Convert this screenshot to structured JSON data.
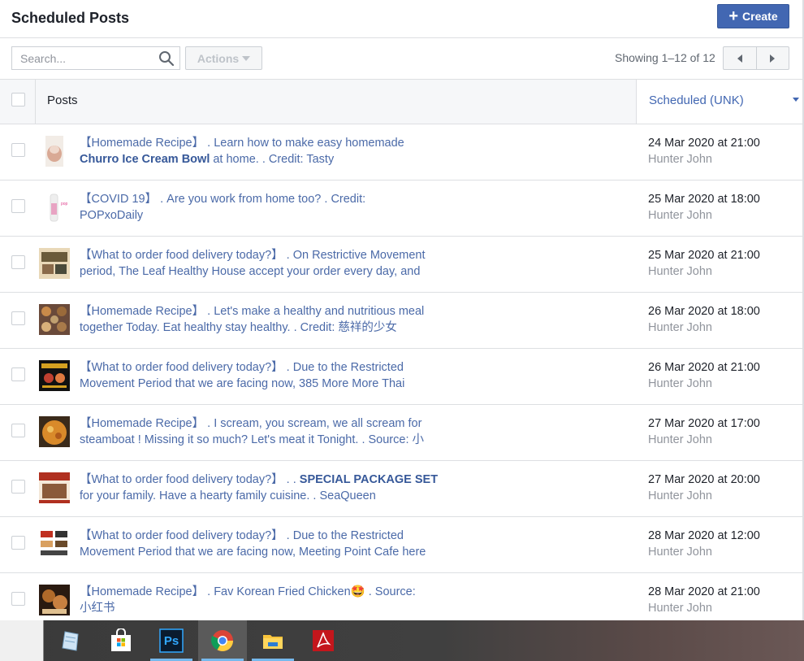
{
  "header": {
    "title": "Scheduled Posts",
    "create_label": "Create"
  },
  "toolbar": {
    "search_placeholder": "Search...",
    "actions_label": "Actions",
    "showing_text": "Showing 1–12 of 12"
  },
  "table": {
    "col_posts": "Posts",
    "col_scheduled": "Scheduled (UNK)",
    "rows": [
      {
        "line1": "【Homemade Recipe】 . Learn how to make easy homemade",
        "bold": "Churro Ice Cream Bowl",
        "line2": " at home. . Credit: Tasty",
        "date": "24 Mar 2020 at 21:00",
        "by": "Hunter John"
      },
      {
        "line1": "【COVID 19】 . Are you work from home too? . Credit:",
        "bold": "",
        "line2": "POPxoDaily",
        "date": "25 Mar 2020 at 18:00",
        "by": "Hunter John"
      },
      {
        "line1": "【What to order food delivery today?】 . On Restrictive Movement",
        "bold": "",
        "line2": "period, The Leaf Healthy House accept your order every day, and",
        "date": "25 Mar 2020 at 21:00",
        "by": "Hunter John"
      },
      {
        "line1": "【Homemade Recipe】 . Let's make a healthy and nutritious meal",
        "bold": "",
        "line2": "together Today. Eat healthy stay healthy. . Credit: 慈祥的少女",
        "date": "26 Mar 2020 at 18:00",
        "by": "Hunter John"
      },
      {
        "line1": "【What to order food delivery today?】 . Due to the Restricted",
        "bold": "",
        "line2": "Movement Period that we are facing now, 385 More More Thai",
        "date": "26 Mar 2020 at 21:00",
        "by": "Hunter John"
      },
      {
        "line1": "【Homemade Recipe】 . I scream, you scream, we all scream for",
        "bold": "",
        "line2": "steamboat ! Missing it so much? Let's meat it Tonight. . Source: 小",
        "date": "27 Mar 2020 at 17:00",
        "by": "Hunter John"
      },
      {
        "line1": "【What to order food delivery today?】 . . ",
        "bold": "SPECIAL PACKAGE SET",
        "line2": "for your family. Have a hearty family cuisine. . SeaQueen",
        "date": "27 Mar 2020 at 20:00",
        "by": "Hunter John",
        "bold_inline": true
      },
      {
        "line1": "【What to order food delivery today?】 . Due to the Restricted",
        "bold": "",
        "line2": "Movement Period that we are facing now, Meeting Point Cafe here",
        "date": "28 Mar 2020 at 12:00",
        "by": "Hunter John"
      },
      {
        "line1": "【Homemade Recipe】 . Fav Korean Fried Chicken🤩 . Source:",
        "bold": "",
        "line2": "小红书",
        "date": "28 Mar 2020 at 21:00",
        "by": "Hunter John"
      }
    ]
  },
  "taskbar": {
    "apps": [
      "notes-icon",
      "store-icon",
      "photoshop-icon",
      "chrome-icon",
      "file-explorer-icon",
      "acrobat-icon"
    ],
    "photoshop_label": "Ps"
  },
  "colors": {
    "brand_blue": "#4267b2",
    "link_text": "#4b6aa8",
    "muted": "#90949c",
    "border": "#dddfe2"
  }
}
